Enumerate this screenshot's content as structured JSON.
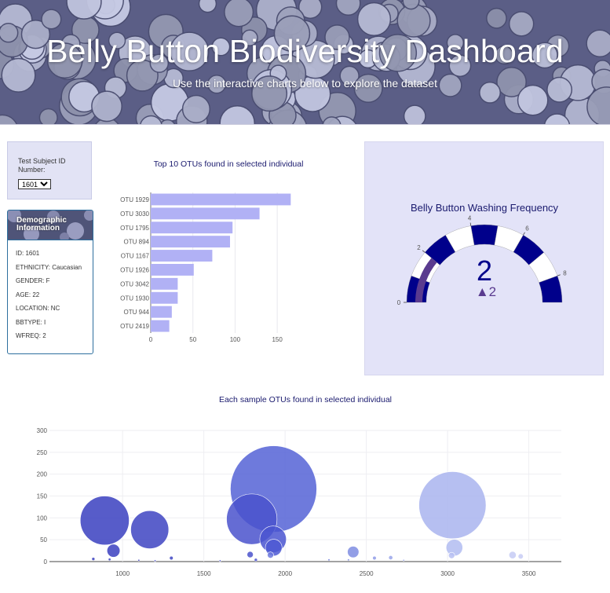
{
  "header": {
    "title": "Belly Button Biodiversity Dashboard",
    "subtitle": "Use the interactive charts below to explore the dataset"
  },
  "selector": {
    "label": "Test Subject ID Number:",
    "selected": "1601"
  },
  "demographic": {
    "title": "Demographic Information",
    "rows": [
      "ID: 1601",
      "ETHNICITY: Caucasian",
      "GENDER: F",
      "AGE: 22",
      "LOCATION: NC",
      "BBTYPE: I",
      "WFREQ: 2"
    ]
  },
  "colors": {
    "bar": "#b1b1f5",
    "gauge_dark": "#00008b",
    "gauge_value": "#5a3b8f",
    "title_text": "#1a1a6e"
  },
  "chart_data": [
    {
      "type": "bar",
      "orientation": "horizontal",
      "title": "Top 10 OTUs found in selected individual",
      "categories": [
        "OTU 1929",
        "OTU 3030",
        "OTU 1795",
        "OTU 894",
        "OTU 1167",
        "OTU 1926",
        "OTU 3042",
        "OTU 1930",
        "OTU 944",
        "OTU 2419"
      ],
      "values": [
        166,
        129,
        97,
        94,
        73,
        51,
        32,
        32,
        25,
        22
      ],
      "xlim": [
        0,
        175
      ],
      "xticks": [
        0,
        50,
        100,
        150
      ],
      "grid": true
    },
    {
      "type": "gauge",
      "title": "Belly Button Washing Frequency",
      "value": 2,
      "delta": "▲2",
      "range": [
        0,
        9
      ],
      "tick_labels": [
        "0",
        "2",
        "4",
        "6",
        "8"
      ]
    },
    {
      "type": "scatter",
      "subtype": "bubble",
      "title": "Each sample OTUs found in selected individual",
      "xlim": [
        550,
        3700
      ],
      "ylim": [
        0,
        300
      ],
      "xticks": [
        1000,
        1500,
        2000,
        2500,
        3000,
        3500
      ],
      "yticks": [
        0,
        50,
        100,
        150,
        200,
        250,
        300
      ],
      "points": [
        {
          "x": 890,
          "y": 94,
          "size": 94,
          "color": "#3a3fbf"
        },
        {
          "x": 1167,
          "y": 73,
          "size": 73,
          "color": "#3e44c2"
        },
        {
          "x": 1795,
          "y": 97,
          "size": 97,
          "color": "#4a52cc"
        },
        {
          "x": 1929,
          "y": 166,
          "size": 166,
          "color": "#5563d6"
        },
        {
          "x": 3030,
          "y": 129,
          "size": 129,
          "color": "#a9b4ef"
        },
        {
          "x": 1926,
          "y": 51,
          "size": 51,
          "color": "#4a55d0"
        },
        {
          "x": 1930,
          "y": 32,
          "size": 32,
          "color": "#4e59d3"
        },
        {
          "x": 944,
          "y": 25,
          "size": 25,
          "color": "#3b40c0"
        },
        {
          "x": 3042,
          "y": 32,
          "size": 32,
          "color": "#b2bcf1"
        },
        {
          "x": 2419,
          "y": 22,
          "size": 22,
          "color": "#7f8de2"
        },
        {
          "x": 1910,
          "y": 15,
          "size": 12,
          "color": "#6d79dd"
        },
        {
          "x": 1785,
          "y": 16,
          "size": 12,
          "color": "#4a52cc"
        },
        {
          "x": 3400,
          "y": 15,
          "size": 14,
          "color": "#c5cbf4"
        },
        {
          "x": 3450,
          "y": 12,
          "size": 10,
          "color": "#c8cdf5"
        },
        {
          "x": 3025,
          "y": 14,
          "size": 12,
          "color": "#b7c0f2"
        },
        {
          "x": 2650,
          "y": 9,
          "size": 8,
          "color": "#9aa6ea"
        },
        {
          "x": 2550,
          "y": 8,
          "size": 7,
          "color": "#8f9be6"
        },
        {
          "x": 1300,
          "y": 8,
          "size": 7,
          "color": "#4046c3"
        },
        {
          "x": 820,
          "y": 6,
          "size": 6,
          "color": "#393ebd"
        },
        {
          "x": 920,
          "y": 5,
          "size": 5,
          "color": "#3a3fbf"
        },
        {
          "x": 1100,
          "y": 3,
          "size": 3,
          "color": "#3c41c0"
        },
        {
          "x": 1820,
          "y": 4,
          "size": 6,
          "color": "#4a52cc"
        },
        {
          "x": 2270,
          "y": 4,
          "size": 4,
          "color": "#7280de"
        },
        {
          "x": 2390,
          "y": 4,
          "size": 4,
          "color": "#7d8be2"
        },
        {
          "x": 2730,
          "y": 3,
          "size": 3,
          "color": "#a0abec"
        },
        {
          "x": 1600,
          "y": 2,
          "size": 2,
          "color": "#4650c9"
        },
        {
          "x": 1200,
          "y": 2,
          "size": 2,
          "color": "#3e44c2"
        }
      ]
    }
  ]
}
